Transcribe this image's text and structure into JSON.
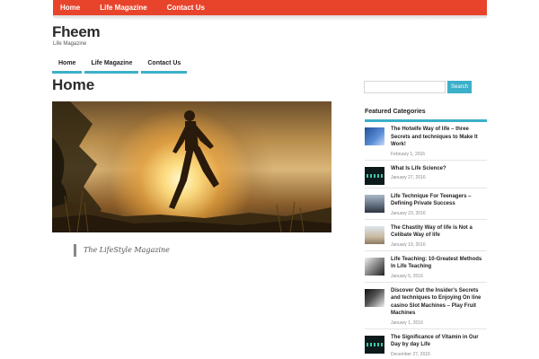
{
  "top_nav": {
    "items": [
      "Home",
      "Life Magazine",
      "Contact Us"
    ]
  },
  "site": {
    "title": "Fheem",
    "description": "Life Magazine"
  },
  "main_nav": {
    "items": [
      "Home",
      "Life Magazine",
      "Contact Us"
    ]
  },
  "page": {
    "title": "Home",
    "quote": "The LifeStyle Magazine"
  },
  "search": {
    "placeholder": "",
    "button_label": "Search"
  },
  "sidebar": {
    "heading": "Featured Categories",
    "posts": [
      {
        "title": "The Hotwife Way of life – three Secrets and techniques to Make It Work!",
        "date": "February 1, 2016",
        "thumb": "blue-abstract"
      },
      {
        "title": "What Is Life Science?",
        "date": "January 27, 2016",
        "thumb": "dark-tech"
      },
      {
        "title": "Life Technique For Teenagers – Defining Private Success",
        "date": "January 23, 2016",
        "thumb": "sky-landscape"
      },
      {
        "title": "The Chastity Way of life is Not a Celibate Way of life",
        "date": "January 19, 2016",
        "thumb": "beach"
      },
      {
        "title": "Life Teaching: 10-Greatest Methods In Life Teaching",
        "date": "January 5, 2016",
        "thumb": "bw-portrait"
      },
      {
        "title": "Discover Out the Insider's Secrets and techniques to Enjoying On line casino Slot Machines – Play Fruit Machines",
        "date": "January 1, 2016",
        "thumb": "bw-hand"
      },
      {
        "title": "The Significance of Vitamin in Our Day by day Life",
        "date": "December 27, 2015",
        "thumb": "dark-tech"
      }
    ]
  },
  "colors": {
    "accent_red": "#e8442c",
    "accent_teal": "#3cb0c9"
  }
}
